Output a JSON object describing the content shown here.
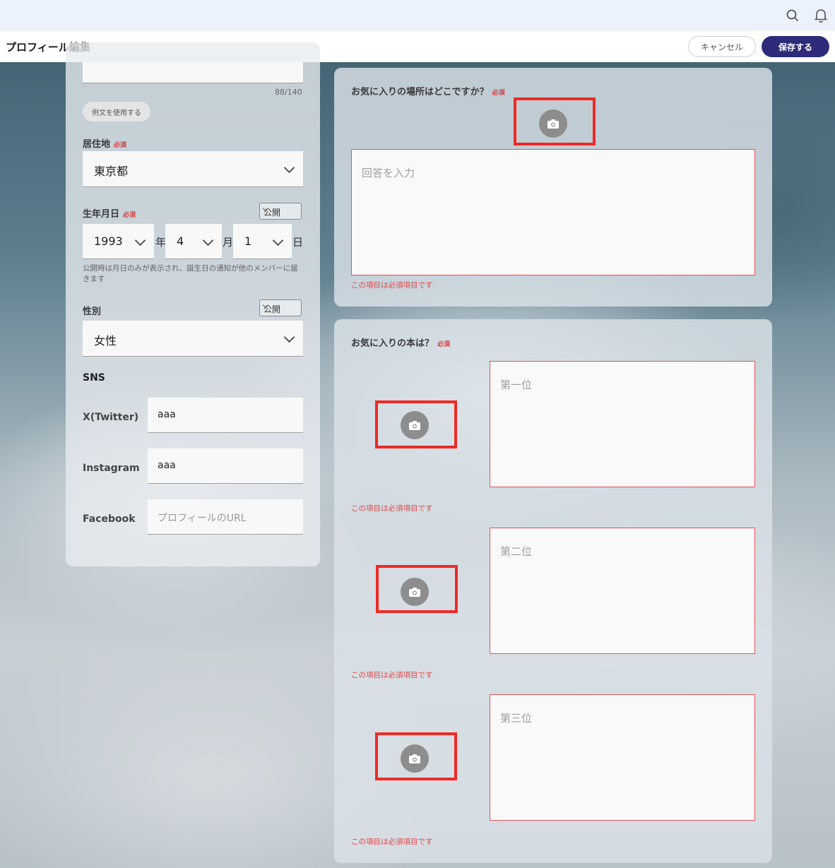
{
  "header": {
    "title": "プロフィール編集",
    "cancel_label": "キャンセル",
    "save_label": "保存する"
  },
  "left": {
    "char_count": "88/140",
    "example_button": "例文を使用する",
    "residence": {
      "label": "居住地",
      "required": "必須",
      "value": "東京都"
    },
    "birthday": {
      "label": "生年月日",
      "required": "必須",
      "visibility": "公開",
      "year": "1993",
      "year_unit": "年",
      "month": "4",
      "month_unit": "月",
      "day": "1",
      "day_unit": "日",
      "note": "公開時は月日のみが表示され、誕生日の通知が他のメンバーに届きます"
    },
    "gender": {
      "label": "性別",
      "visibility": "公開",
      "value": "女性"
    },
    "sns": {
      "heading": "SNS",
      "twitter_label": "X(Twitter)",
      "twitter_value": "aaa",
      "instagram_label": "Instagram",
      "instagram_value": "aaa",
      "facebook_label": "Facebook",
      "facebook_placeholder": "プロフィールのURL"
    }
  },
  "q1": {
    "title": "お気に入りの場所はどこですか？",
    "required": "必須",
    "placeholder": "回答を入力",
    "error": "この項目は必須項目です"
  },
  "q2": {
    "title": "お気に入りの本は？",
    "required": "必須",
    "items": [
      {
        "placeholder": "第一位",
        "error": "この項目は必須項目です"
      },
      {
        "placeholder": "第二位",
        "error": "この項目は必須項目です"
      },
      {
        "placeholder": "第三位",
        "error": "この項目は必須項目です"
      }
    ]
  },
  "colors": {
    "accent": "#2e2b7a",
    "error": "#e04848",
    "highlight": "#ee2a24"
  },
  "icons": [
    "search-icon",
    "bell-icon",
    "camera-icon",
    "chevron-down-icon"
  ]
}
